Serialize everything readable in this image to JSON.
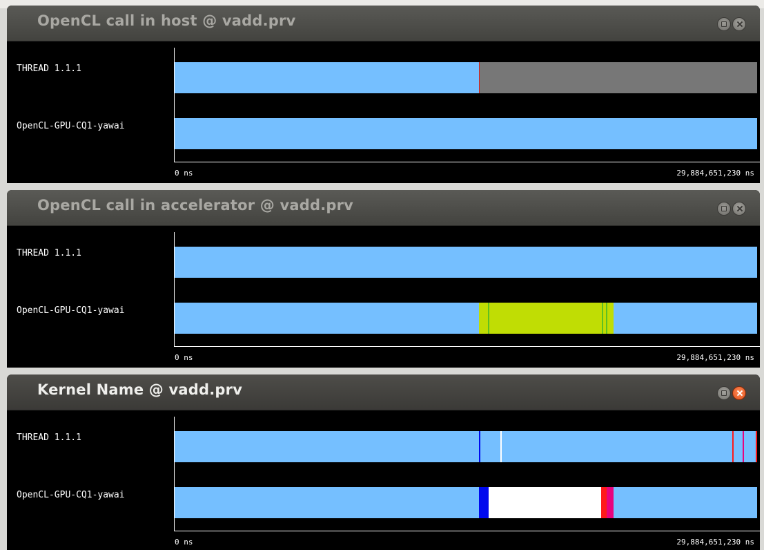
{
  "colors": {
    "running": "#75bfff",
    "idle": "#777777",
    "accel_call": "#c0dd04",
    "accel_marker": "#5ebf22",
    "host_marker": "#d7211c",
    "kernel_blue": "#0009ee",
    "kernel_white": "#ffffff",
    "kernel_red": "#ff1a1a",
    "kernel_magenta": "#e8047e"
  },
  "windows": [
    {
      "title": "OpenCL call in host @ vadd.prv",
      "active": false,
      "rows": [
        {
          "label": "THREAD 1.1.1",
          "segments": [
            {
              "start": 0.0,
              "end": 0.523,
              "color": "#75bfff"
            },
            {
              "start": 0.5225,
              "end": 0.5245,
              "color": "#d7211c"
            },
            {
              "start": 0.524,
              "end": 1.0,
              "color": "#777777"
            }
          ]
        },
        {
          "label": "OpenCL-GPU-CQ1-yawai",
          "segments": [
            {
              "start": 0.0,
              "end": 1.0,
              "color": "#75bfff"
            }
          ]
        }
      ],
      "axis": {
        "start_label": "0 ns",
        "end_label": "29,884,651,230 ns"
      }
    },
    {
      "title": "OpenCL call in accelerator @ vadd.prv",
      "active": false,
      "rows": [
        {
          "label": "THREAD 1.1.1",
          "segments": [
            {
              "start": 0.0,
              "end": 1.0,
              "color": "#75bfff"
            }
          ]
        },
        {
          "label": "OpenCL-GPU-CQ1-yawai",
          "segments": [
            {
              "start": 0.0,
              "end": 1.0,
              "color": "#75bfff"
            },
            {
              "start": 0.5225,
              "end": 0.7535,
              "color": "#c0dd04"
            },
            {
              "start": 0.5375,
              "end": 0.5395,
              "color": "#5ebf22"
            },
            {
              "start": 0.7335,
              "end": 0.7355,
              "color": "#5ebf22"
            },
            {
              "start": 0.7405,
              "end": 0.7425,
              "color": "#5ebf22"
            }
          ]
        }
      ],
      "axis": {
        "start_label": "0 ns",
        "end_label": "29,884,651,230 ns"
      }
    },
    {
      "title": "Kernel Name @ vadd.prv",
      "active": true,
      "rows": [
        {
          "label": "THREAD 1.1.1",
          "segments": [
            {
              "start": 0.0,
              "end": 1.0,
              "color": "#75bfff"
            },
            {
              "start": 0.5225,
              "end": 0.5245,
              "color": "#0009ee"
            },
            {
              "start": 0.5595,
              "end": 0.5615,
              "color": "#ffffff"
            },
            {
              "start": 0.957,
              "end": 0.959,
              "color": "#ff1a1a"
            },
            {
              "start": 0.975,
              "end": 0.977,
              "color": "#e8047e"
            },
            {
              "start": 0.998,
              "end": 1.0,
              "color": "#ff1a1a"
            }
          ]
        },
        {
          "label": "OpenCL-GPU-CQ1-yawai",
          "segments": [
            {
              "start": 0.0,
              "end": 1.0,
              "color": "#75bfff"
            },
            {
              "start": 0.5225,
              "end": 0.539,
              "color": "#0009ee"
            },
            {
              "start": 0.539,
              "end": 0.732,
              "color": "#ffffff"
            },
            {
              "start": 0.732,
              "end": 0.7415,
              "color": "#ff1a1a"
            },
            {
              "start": 0.7415,
              "end": 0.754,
              "color": "#e8047e"
            }
          ]
        }
      ],
      "axis": {
        "start_label": "0 ns",
        "end_label": "29,884,651,230 ns"
      }
    }
  ]
}
